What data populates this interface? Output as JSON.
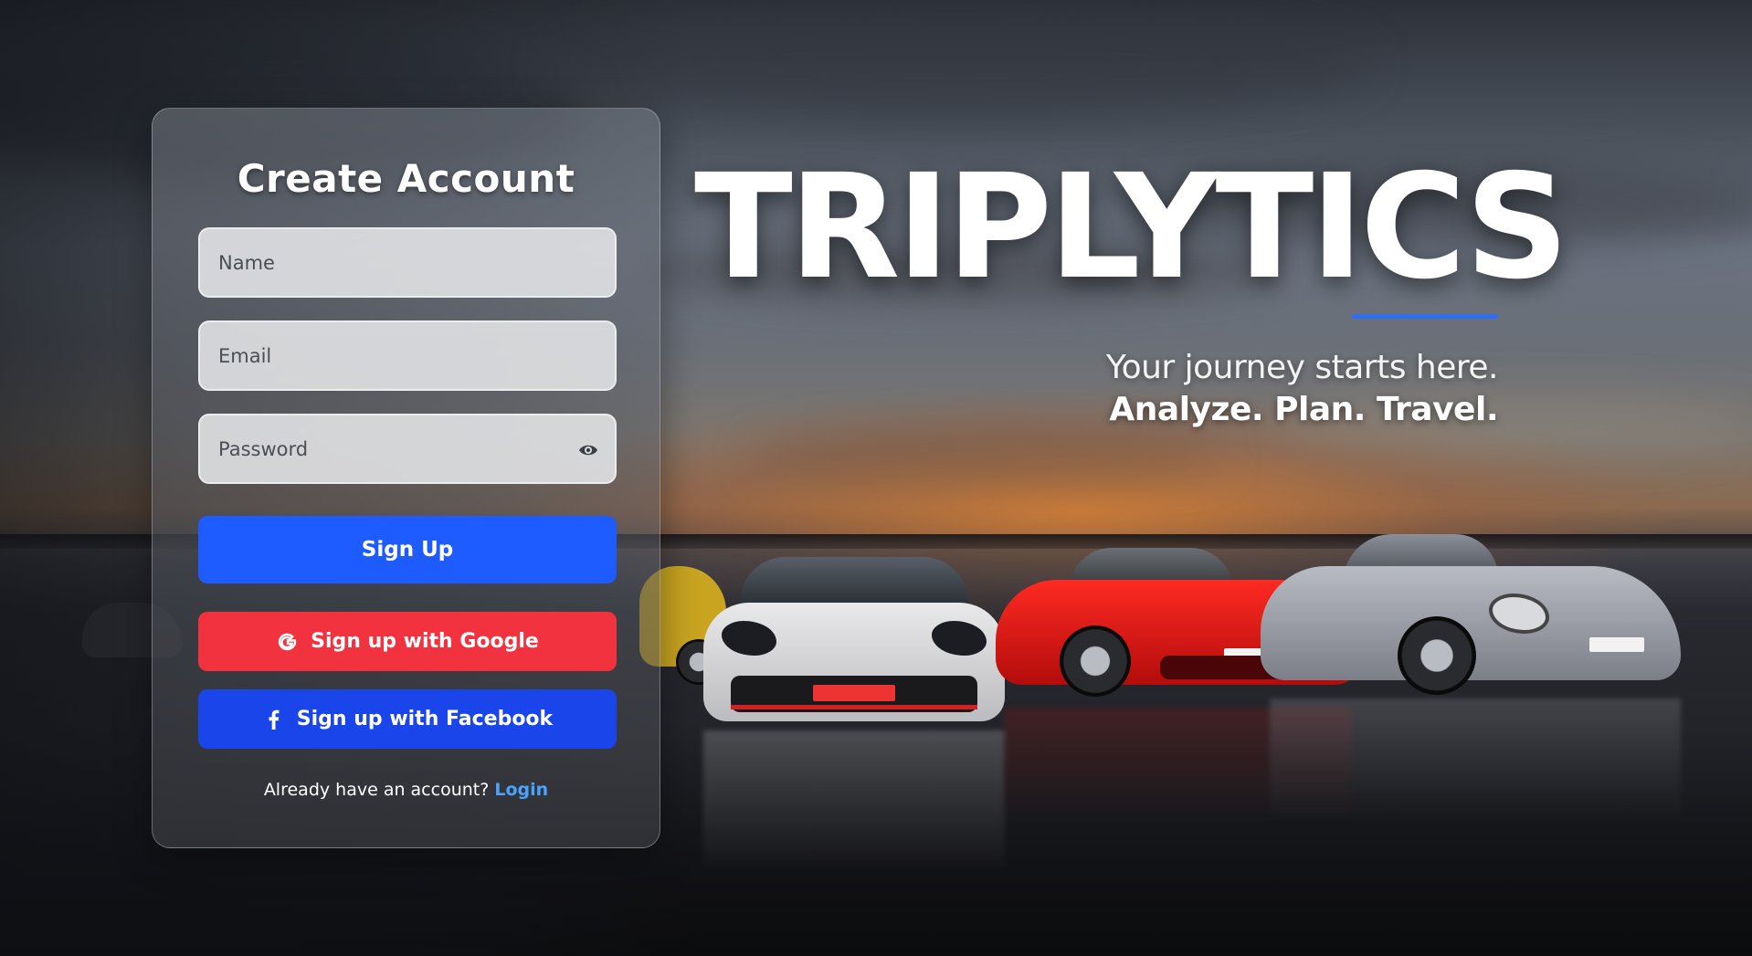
{
  "form": {
    "title": "Create Account",
    "name_placeholder": "Name",
    "email_placeholder": "Email",
    "password_placeholder": "Password",
    "signup_label": "Sign Up",
    "google_label": "Sign up with Google",
    "facebook_label": "Sign up with Facebook",
    "login_prompt": "Already have an account?",
    "login_label": "Login"
  },
  "brand": {
    "name": "TRIPLYTICS",
    "tagline": "Your journey starts here.",
    "slogan": "Analyze. Plan. Travel."
  },
  "colors": {
    "signup": "#1e5cff",
    "google": "#f2323f",
    "facebook": "#1945ea",
    "accent_underline": "#2f6df3",
    "login_link": "#4aa3ff"
  },
  "icons": {
    "google": "google-icon",
    "facebook": "facebook-icon",
    "password_toggle": "eye-icon"
  }
}
